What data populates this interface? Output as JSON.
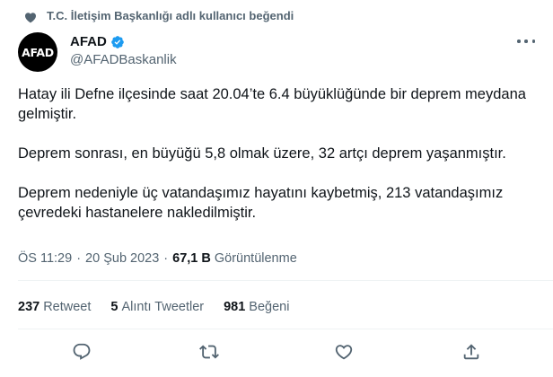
{
  "social_context": {
    "text": "T.C. İletişim Başkanlığı adlı kullanıcı beğendi",
    "icon": "heart-icon"
  },
  "author": {
    "avatar_text": "AFAD",
    "name": "AFAD",
    "handle": "@AFADBaskanlik",
    "verified": true
  },
  "tweet": {
    "paragraphs": [
      "Hatay ili Defne ilçesinde saat 20.04’te 6.4 büyüklüğünde bir deprem meydana gelmiştir.",
      "Deprem sonrası, en büyüğü 5,8 olmak üzere, 32 artçı deprem yaşanmıştır.",
      "Deprem nedeniyle üç vatandaşımız hayatını kaybetmiş, 213 vatandaşımız çevredeki hastanelere nakledilmiştir."
    ]
  },
  "meta": {
    "time": "ÖS 11:29",
    "separator": "·",
    "date": "20 Şub 2023",
    "views_count": "67,1 B",
    "views_label": "Görüntülenme"
  },
  "stats": {
    "retweets": {
      "count": "237",
      "label": "Retweet"
    },
    "quotes": {
      "count": "5",
      "label": "Alıntı Tweetler"
    },
    "likes": {
      "count": "981",
      "label": "Beğeni"
    }
  },
  "actions": [
    "reply-icon",
    "retweet-icon",
    "like-icon",
    "share-icon"
  ],
  "colors": {
    "text": "#0f1419",
    "secondary": "#536471",
    "verified": "#1d9bf0",
    "divider": "#eff3f4"
  }
}
